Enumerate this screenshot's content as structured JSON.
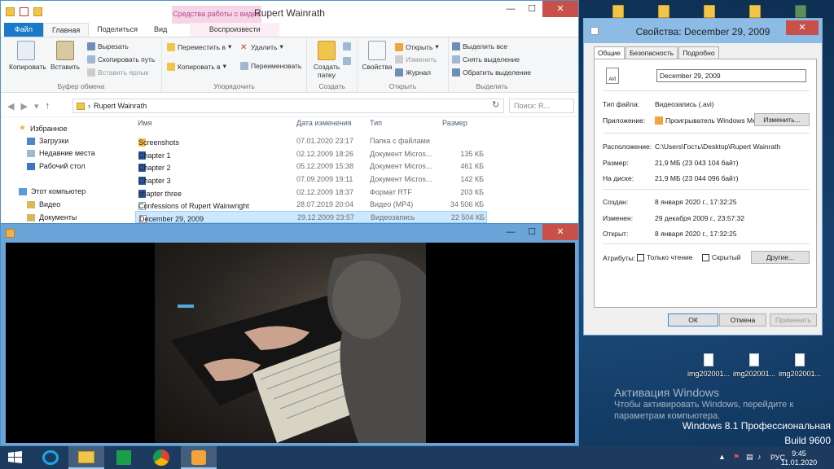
{
  "desktop": {
    "files": [
      "img202001...",
      "img202001...",
      "img202001..."
    ],
    "activation_title": "Активация Windows",
    "activation_text": "Чтобы активировать Windows, перейдите к параметрам компьютера.",
    "edition_line1": "Windows 8.1 Профессиональная",
    "edition_line2": "Build 9600"
  },
  "explorer": {
    "title": "Rupert Wainrath",
    "context_tab_header": "Средства работы с видео",
    "tabs": [
      "Файл",
      "Главная",
      "Поделиться",
      "Вид",
      "Воспроизвести"
    ],
    "ribbon": {
      "clipboard": {
        "copy": "Копировать",
        "paste": "Вставить",
        "cut": "Вырезать",
        "copy_path": "Скопировать путь",
        "paste_shortcut": "Вставить ярлык",
        "group": "Буфер обмена"
      },
      "organize": {
        "move_to": "Переместить в",
        "copy_to": "Копировать в",
        "delete": "Удалить",
        "rename": "Переименовать",
        "group": "Упорядочить"
      },
      "new": {
        "new_folder": "Создать папку",
        "group": "Создать"
      },
      "open": {
        "properties": "Свойства",
        "open": "Открыть",
        "edit": "Изменить",
        "history": "Журнал",
        "group": "Открыть"
      },
      "select": {
        "select_all": "Выделить все",
        "select_none": "Снять выделение",
        "invert": "Обратить выделение",
        "group": "Выделить"
      }
    },
    "address": "Rupert Wainrath",
    "search_placeholder": "Поиск: R...",
    "nav": {
      "favorites": "Избранное",
      "downloads": "Загрузки",
      "recent": "Недавние места",
      "desktop": "Рабочий стол",
      "computer": "Этот компьютер",
      "video": "Видео",
      "documents": "Документы"
    },
    "columns": {
      "name": "Имя",
      "date": "Дата изменения",
      "type": "Тип",
      "size": "Размер"
    },
    "files": [
      {
        "name": "Screenshots",
        "date": "07.01.2020 23:17",
        "type": "Папка с файлами",
        "size": ""
      },
      {
        "name": "Chapter 1",
        "date": "02.12.2009 18:26",
        "type": "Документ Micros...",
        "size": "135 КБ"
      },
      {
        "name": "Chapter 2",
        "date": "05.12.2009 15:38",
        "type": "Документ Micros...",
        "size": "461 КБ"
      },
      {
        "name": "Chapter 3",
        "date": "07.09.2009 19:11",
        "type": "Документ Micros...",
        "size": "142 КБ"
      },
      {
        "name": "chapter three",
        "date": "02.12.2009 18:37",
        "type": "Формат RTF",
        "size": "203 КБ"
      },
      {
        "name": "Confessions of Rupert Wainwright",
        "date": "28.07.2019 20:04",
        "type": "Видео (MP4)",
        "size": "34 506 КБ"
      },
      {
        "name": "December 29, 2009",
        "date": "29.12.2009 23:57",
        "type": "Видеозапись",
        "size": "22 504 КБ"
      }
    ]
  },
  "properties": {
    "title": "Свойства: December 29, 2009",
    "tabs": [
      "Общие",
      "Безопасность",
      "Подробно"
    ],
    "file_name": "December 29, 2009",
    "file_type_label": "Тип файла:",
    "file_type": "Видеозапись (.avi)",
    "app_label": "Приложение:",
    "app": "Проигрыватель Windows Media",
    "change_btn": "Изменить...",
    "location_label": "Расположение:",
    "location": "C:\\Users\\Гость\\Desktop\\Rupert Wainrath",
    "size_label": "Размер:",
    "size": "21,9 МБ (23 043 104 байт)",
    "disk_label": "На диске:",
    "disk": "21,9 МБ (23 044 096 байт)",
    "created_label": "Создан:",
    "created": "8 января 2020 г., 17:32:25",
    "modified_label": "Изменен:",
    "modified": "29 декабря 2009 г., 23:57:32",
    "opened_label": "Открыт:",
    "opened": "8 января 2020 г., 17:32:25",
    "attrs_label": "Атрибуты:",
    "readonly": "Только чтение",
    "hidden": "Скрытый",
    "other_btn": "Другие...",
    "ok": "ОК",
    "cancel": "Отмена",
    "apply": "Применить",
    "avi_badge": "AVI"
  },
  "taskbar": {
    "lang": "РУС",
    "time": "9:45",
    "date": "11.01.2020"
  },
  "colors": {
    "accent": "#1979ca",
    "close": "#c7504b",
    "selection": "#cce8ff"
  }
}
